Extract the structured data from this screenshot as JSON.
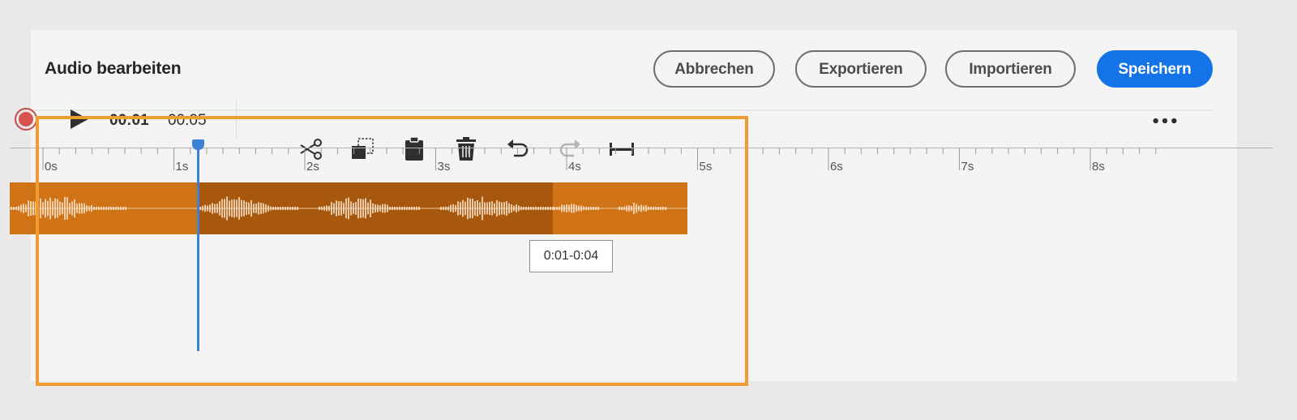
{
  "header": {
    "title": "Audio bearbeiten",
    "buttons": {
      "cancel": "Abbrechen",
      "export": "Exportieren",
      "import": "Importieren",
      "save": "Speichern"
    }
  },
  "toolbar": {
    "current_time": "00:01",
    "total_time": "00:05",
    "icons": [
      "record-icon",
      "play-icon",
      "scissors-icon",
      "copy-icon",
      "paste-icon",
      "trash-icon",
      "undo-icon",
      "redo-icon",
      "fit-width-icon",
      "more-icon"
    ],
    "redo_enabled": false
  },
  "timeline": {
    "tick_labels": [
      "0s",
      "1s",
      "2s",
      "3s",
      "4s",
      "5s",
      "6s",
      "7s",
      "8s"
    ],
    "clip_duration_s": 5.2,
    "selection_start_s": 1.4,
    "selection_end_s": 4.1,
    "playhead_s": 1.4,
    "selection_tooltip": "0:01-0:04"
  },
  "colors": {
    "accent": "#1473e6",
    "clip": "#d07316",
    "clip_selected": "#a8580d",
    "playhead": "#3b82d7",
    "highlight": "#ef9c33",
    "record": "#d9534f"
  }
}
